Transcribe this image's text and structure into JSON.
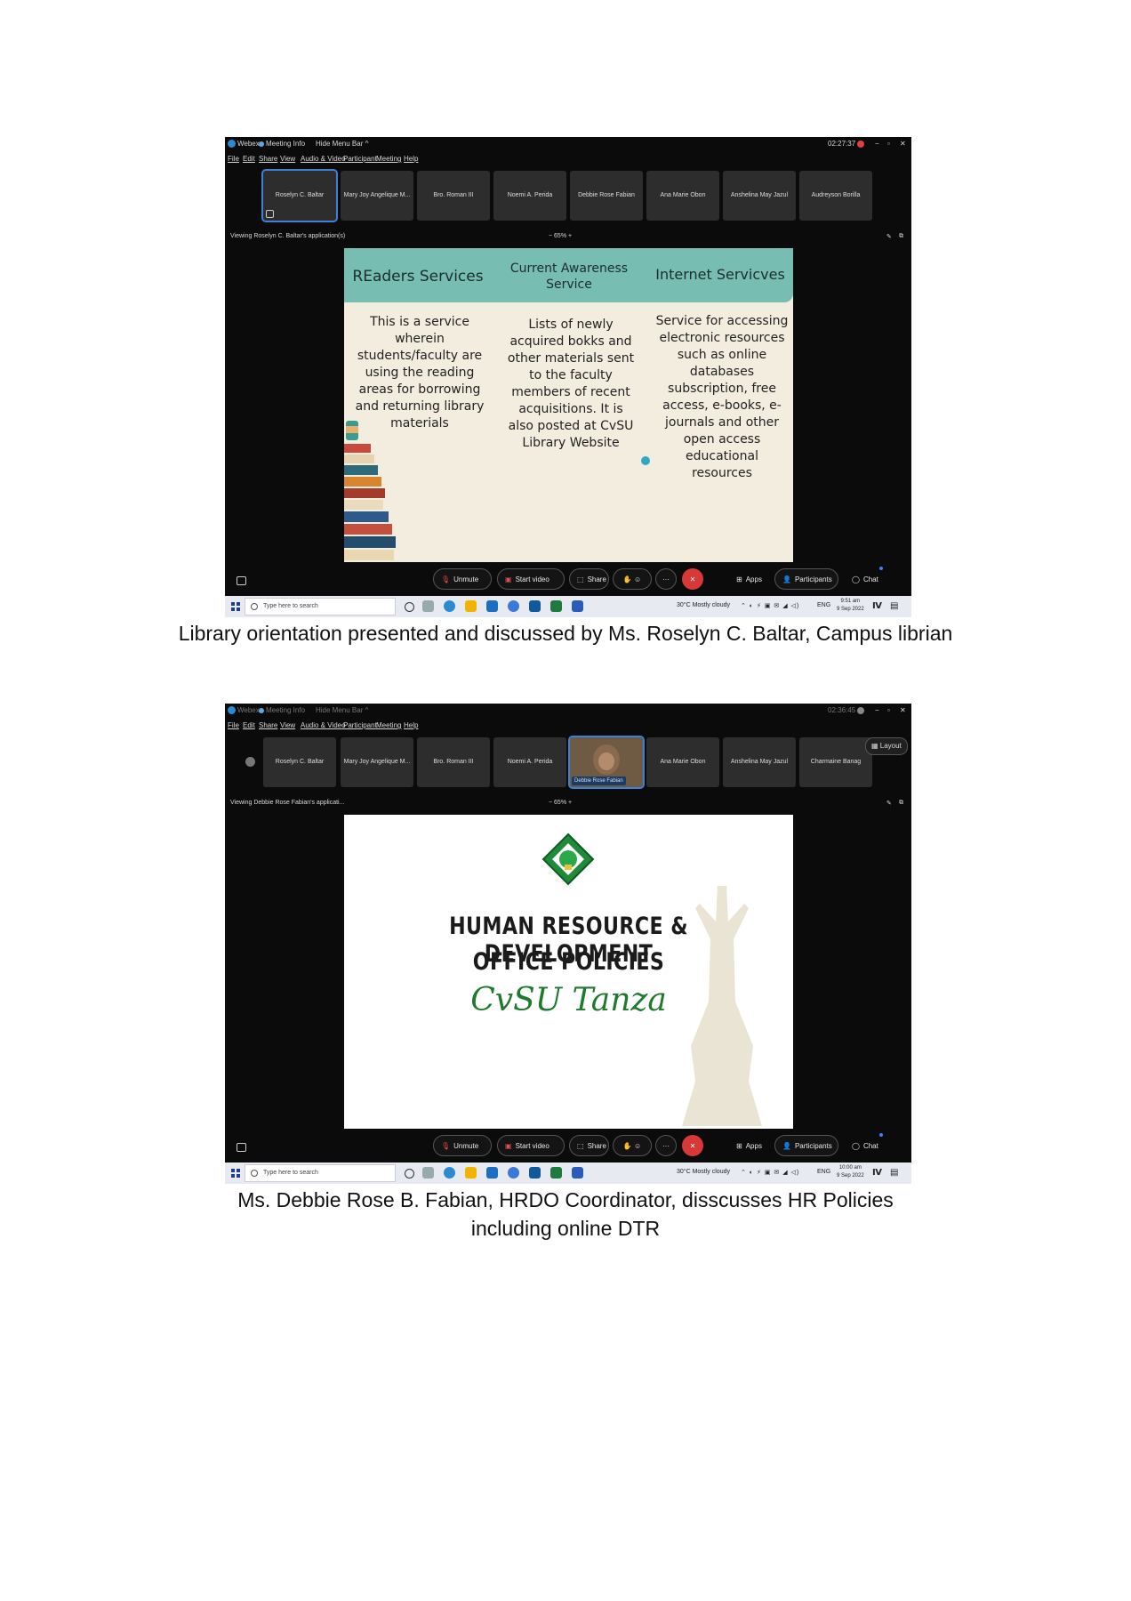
{
  "screenshots": [
    {
      "app": "Webex",
      "meeting_info": "Meeting Info",
      "hide_menu": "Hide Menu Bar ^",
      "clock": "02:27:37",
      "menus": [
        "File",
        "Edit",
        "Share",
        "View",
        "Audio & Video",
        "Participant",
        "Meeting",
        "Help"
      ],
      "participants": [
        "Roselyn C. Baltar",
        "Mary Joy Angelique M...",
        "Bro. Roman III",
        "Noemi A. Perida",
        "Debbie Rose Fabian",
        "Ana Marie Obon",
        "Anshelina May Jazul",
        "Audreyson Borilla"
      ],
      "viewing": "Viewing Roselyn C. Baltar's application(s)",
      "zoom": "−  65%  +",
      "slide": {
        "headers": [
          "REaders Services",
          "Current Awareness Service",
          "Internet Servicves"
        ],
        "columns": [
          "This is a service wherein students/faculty are using the reading areas for borrowing and returning library materials",
          "Lists of newly acquired bokks and other materials sent to the faculty members of recent acquisitions. It is also posted at CvSU Library Website",
          "Service for accessing electronic resources such as online databases subscription, free access, e-books, e-journals and other open access educational resources"
        ]
      },
      "controls": {
        "unmute": "Unmute",
        "start_video": "Start video",
        "share": "Share",
        "apps": "Apps",
        "participants": "Participants",
        "chat": "Chat"
      },
      "taskbar": {
        "search": "Type here to search",
        "weather": "30°C  Mostly cloudy",
        "lang": "ENG",
        "time": "9:51 am",
        "date": "9 Sep 2022"
      },
      "caption": "Library orientation presented and discussed by Ms. Roselyn C. Baltar, Campus librian"
    },
    {
      "app": "Webex",
      "meeting_info": "Meeting Info",
      "hide_menu": "Hide Menu Bar ^",
      "clock": "02:36:45",
      "menus": [
        "File",
        "Edit",
        "Share",
        "View",
        "Audio & Video",
        "Participant",
        "Meeting",
        "Help"
      ],
      "participants": [
        "Roselyn C. Baltar",
        "Mary Joy Angelique M...",
        "Bro. Roman III",
        "Noemi A. Perida",
        "Debbie Rose Fabian",
        "Ana Marie Obon",
        "Anshelina May Jazul",
        "Charmaine Banag"
      ],
      "layout": "Layout",
      "viewing": "Viewing Debbie Rose Fabian's applicati...",
      "zoom": "−  65%  +",
      "slide": {
        "title_line1": "HUMAN RESOURCE & DEVELOPMENT",
        "title_line2": "OFFICE POLICIES",
        "subtitle": "CvSU Tanza"
      },
      "controls": {
        "unmute": "Unmute",
        "start_video": "Start video",
        "share": "Share",
        "apps": "Apps",
        "participants": "Participants",
        "chat": "Chat"
      },
      "taskbar": {
        "search": "Type here to search",
        "weather": "30°C  Mostly cloudy",
        "lang": "ENG",
        "time": "10:00 am",
        "date": "9 Sep 2022"
      },
      "caption_line1": "Ms. Debbie Rose B. Fabian, HRDO Coordinator, disscusses HR Policies",
      "caption_line2": "including online DTR"
    }
  ],
  "colors": {
    "slide1_header": "#78bdb2",
    "slide1_bg": "#f3eddf",
    "accent_green": "#1f7a2e",
    "end_button": "#d93838",
    "active_tile": "#3b82d6"
  }
}
